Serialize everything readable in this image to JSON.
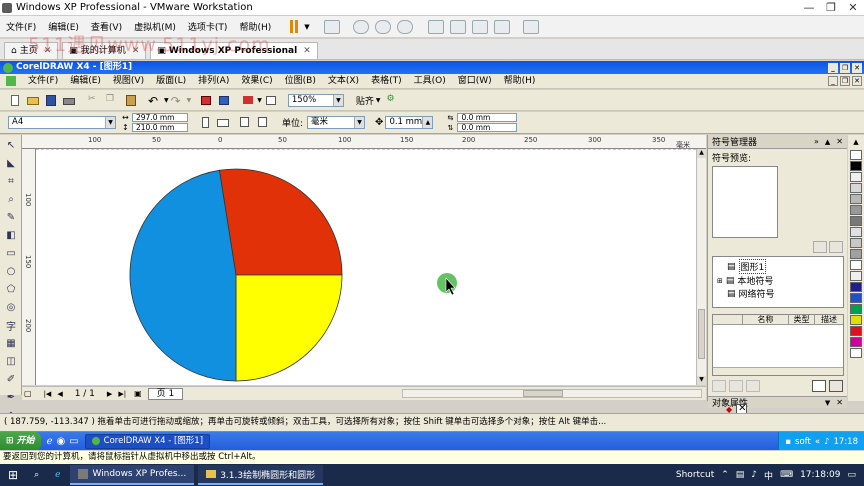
{
  "vmware": {
    "title": "Windows XP Professional - VMware Workstation",
    "menu": [
      "文件(F)",
      "编辑(E)",
      "查看(V)",
      "虚拟机(M)",
      "选项卡(T)",
      "帮助(H)"
    ],
    "tabs": [
      {
        "label": "主页"
      },
      {
        "label": "我的计算机"
      },
      {
        "label": "Windows XP Professional"
      }
    ],
    "hint": "要返回到您的计算机，请将鼠标指针从虚拟机中移出或按 Ctrl+Alt。"
  },
  "watermark": "511遇见www.511yj.com",
  "coreldraw": {
    "title": "CorelDRAW X4 - [图形1]",
    "menu": [
      "文件(F)",
      "编辑(E)",
      "视图(V)",
      "版面(L)",
      "排列(A)",
      "效果(C)",
      "位图(B)",
      "文本(X)",
      "表格(T)",
      "工具(O)",
      "窗口(W)",
      "帮助(H)"
    ],
    "zoom": "150%",
    "snap_label": "贴齐",
    "page_size": "A4",
    "width": "297.0 mm",
    "height": "210.0 mm",
    "units_label": "单位:",
    "units": "毫米",
    "nudge": "0.1 mm",
    "dup_x": "0.0 mm",
    "dup_y": "0.0 mm",
    "ruler_top": [
      "100",
      "50",
      "0",
      "50",
      "100",
      "150",
      "200",
      "250",
      "300",
      "350",
      "毫米"
    ],
    "ruler_left": [
      "100",
      "150",
      "200"
    ],
    "page_nav": "1 / 1",
    "page_tab": "页 1",
    "status": "( 187.759, -113.347 )  拖着单击可进行拖动或缩放；再单击可旋转或倾斜；双击工具，可选择所有对象；按住 Shift 键单击可选择多个对象；按住 Alt 键单击..."
  },
  "pie": {
    "colors": {
      "red": "#e03108",
      "yellow": "#ffff00",
      "blue": "#1290e0"
    }
  },
  "docker": {
    "title": "符号管理器",
    "preview_label": "符号预览:",
    "tree": [
      "图形1",
      "本地符号",
      "网络符号"
    ],
    "columns": [
      "名称",
      "类型",
      "描述"
    ],
    "props_title": "对象属性"
  },
  "palette": [
    "#ffffff",
    "#000000",
    "#f0f0f0",
    "#d8d8d8",
    "#b8b8b8",
    "#989898",
    "#787878",
    "#e0e0e0",
    "#c8c8c8",
    "#a0a0a0",
    "#ffffff",
    "#f0f0f0",
    "#1e1e8c",
    "#2050c8",
    "#00a050",
    "#e0e000",
    "#e01020",
    "#d000a0",
    "#ffffff"
  ],
  "xp": {
    "start": "开始",
    "task": "CorelDRAW X4 - [图形1]",
    "tray_text": "soft",
    "clock": "17:18"
  },
  "win10": {
    "tasks": [
      "Windows XP Profes...",
      "3.1.3绘制椭圆形和圆形"
    ],
    "shortcut": "Shortcut",
    "ime": "中",
    "clock": "17:18:09"
  }
}
